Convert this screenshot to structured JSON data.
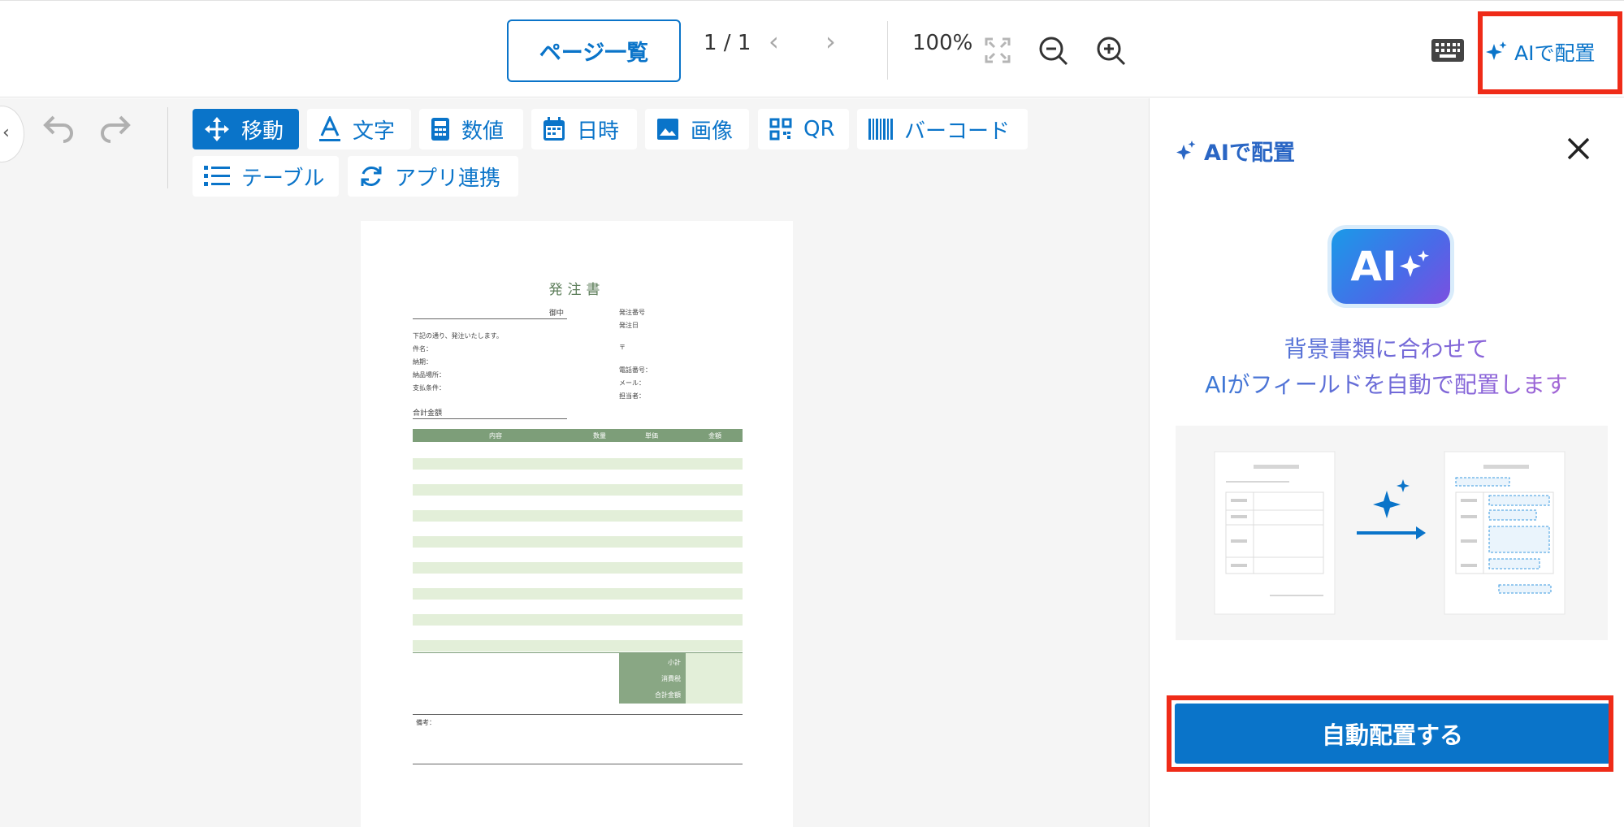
{
  "toolbar": {
    "pages_button": "ページ一覧",
    "page_indicator": "1 / 1",
    "zoom_level": "100%",
    "ai_button": "AIで配置"
  },
  "tools": [
    {
      "label": "移動",
      "icon": "move-icon",
      "active": true
    },
    {
      "label": "文字",
      "icon": "text-icon"
    },
    {
      "label": "数値",
      "icon": "calculator-icon"
    },
    {
      "label": "日時",
      "icon": "calendar-icon"
    },
    {
      "label": "画像",
      "icon": "image-icon"
    },
    {
      "label": "QR",
      "icon": "qr-icon"
    },
    {
      "label": "バーコード",
      "icon": "barcode-icon"
    },
    {
      "label": "テーブル",
      "icon": "list-icon"
    },
    {
      "label": "アプリ連携",
      "icon": "sync-icon"
    }
  ],
  "document": {
    "title": "発注書",
    "recipient_suffix": "御中",
    "order_number": "発注番号",
    "order_date": "発注日",
    "postal_mark": "〒",
    "intro": "下記の通り、発注いたします。",
    "subject": "件名：",
    "deadline": "納期：",
    "delivery_place": "納品場所：",
    "payment_terms": "支払条件：",
    "phone": "電話番号：",
    "email": "メール：",
    "contact": "担当者：",
    "total_amount": "合計金額",
    "col_description": "内容",
    "col_qty": "数量",
    "col_unit_price": "単価",
    "col_amount": "金額",
    "subtotal": "小計",
    "tax": "消費税",
    "grand_total": "合計金額",
    "remarks": "備考："
  },
  "panel": {
    "title": "AIで配置",
    "logo_text": "AI",
    "description_line1": "背景書類に合わせて",
    "description_line2": "AIがフィールドを自動で配置します",
    "auto_place_button": "自動配置する"
  },
  "colors": {
    "accent": "#0a74c9",
    "highlight": "#ef2b18",
    "doc_green": "#7d9e79",
    "doc_stripe": "#e3efd9"
  }
}
